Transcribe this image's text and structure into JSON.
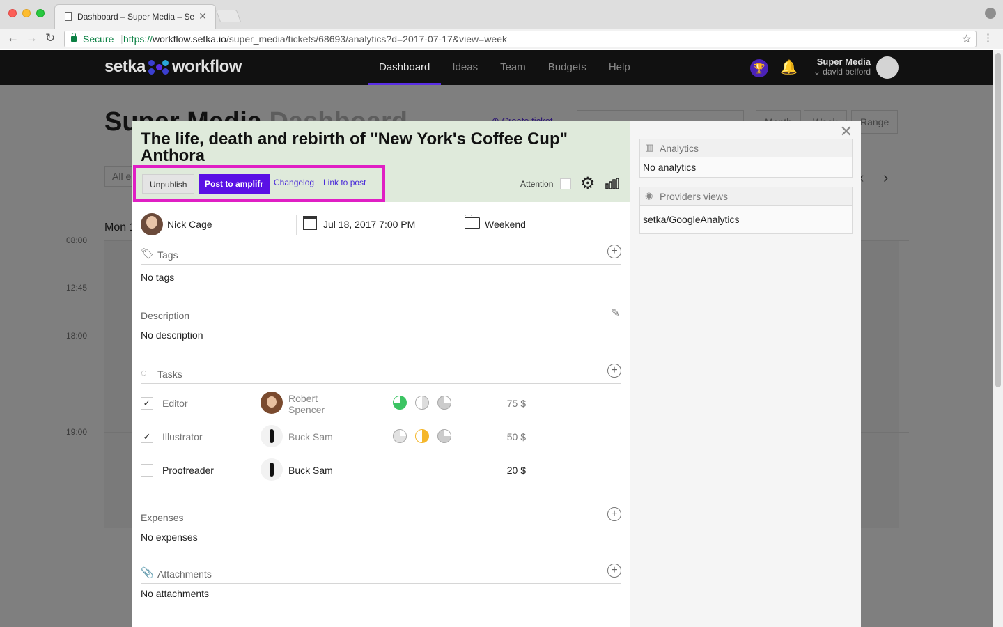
{
  "browser": {
    "tab_title": "Dashboard – Super Media – Se",
    "secure_label": "Secure",
    "url_scheme": "https://",
    "url_host": "workflow.setka.io",
    "url_path": "/super_media/tickets/68693/analytics?d=2017-07-17&view=week"
  },
  "app": {
    "logo_left": "setka",
    "logo_right": "workflow",
    "nav": [
      "Dashboard",
      "Ideas",
      "Team",
      "Budgets",
      "Help"
    ],
    "active_nav": "Dashboard",
    "account_name": "Super Media",
    "account_user": "david belford",
    "accent_color": "#5a2ee6"
  },
  "background": {
    "title_main": "Super Media",
    "title_muted": "Dashboard",
    "create_link": "Create ticket",
    "segments": [
      "Month",
      "Week",
      "Range"
    ],
    "filter": "All e",
    "day": "Mon 1",
    "times": [
      "08:00",
      "12:45",
      "18:00",
      "19:00"
    ]
  },
  "ticket": {
    "title": "The life, death and rebirth of \"New York's Coffee Cup\" Anthora",
    "unpublish": "Unpublish",
    "post_amplifr": "Post to amplifr",
    "changelog": "Changelog",
    "link_to_post": "Link to post",
    "attention": "Attention",
    "author": "Nick Cage",
    "date": "Jul 18, 2017 7:00 PM",
    "folder": "Weekend"
  },
  "sections": {
    "tags_label": "Tags",
    "tags_empty": "No tags",
    "description_label": "Description",
    "description_empty": "No description",
    "tasks_label": "Tasks",
    "expenses_label": "Expenses",
    "expenses_empty": "No expenses",
    "attachments_label": "Attachments",
    "attachments_empty": "No attachments"
  },
  "tasks": [
    {
      "role": "Editor",
      "person": "Robert Spencer",
      "price": "75 $",
      "checked": true
    },
    {
      "role": "Illustrator",
      "person": "Buck Sam",
      "price": "50 $",
      "checked": true
    },
    {
      "role": "Proofreader",
      "person": "Buck Sam",
      "price": "20 $",
      "checked": false
    }
  ],
  "sidebar": {
    "analytics_title": "Analytics",
    "analytics_empty": "No analytics",
    "providers_title": "Providers views",
    "providers_value": "setka/GoogleAnalytics"
  },
  "highlight_color": "#e01fc4"
}
